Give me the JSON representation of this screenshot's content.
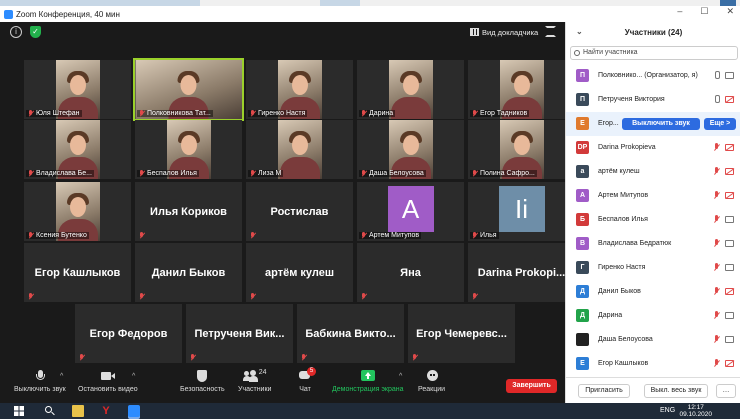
{
  "window": {
    "title": "Zoom Конференция, 40 мин",
    "controls": [
      "–",
      "☐",
      "✕"
    ]
  },
  "topbar": {
    "view_label": "Вид докладчика"
  },
  "colors": {
    "active_border": "#9bd12b",
    "end_button": "#e02828",
    "share": "#22c55e",
    "accent_blue": "#2d6be0"
  },
  "tiles": [
    {
      "name": "Юля Штефан",
      "kind": "video"
    },
    {
      "name": "Полковникова Тат...",
      "kind": "video",
      "active": true
    },
    {
      "name": "Гиренко Настя",
      "kind": "video"
    },
    {
      "name": "Дарина",
      "kind": "video"
    },
    {
      "name": "Егор Тадников",
      "kind": "video"
    },
    {
      "name": "Владислава Бе...",
      "kind": "video"
    },
    {
      "name": "Беспалов Илья",
      "kind": "video"
    },
    {
      "name": "Лиза М",
      "kind": "video"
    },
    {
      "name": "Даша Белоусова",
      "kind": "video"
    },
    {
      "name": "Полина Сафро...",
      "kind": "video"
    },
    {
      "name": "Ксения Бутенко",
      "kind": "video"
    },
    {
      "name": "Илья Кориков",
      "kind": "text"
    },
    {
      "name": "Ростислав",
      "kind": "text"
    },
    {
      "name": "Артем Митупов",
      "kind": "avatar",
      "letter": "A",
      "color": "#a05cc7"
    },
    {
      "name": "Илья",
      "kind": "avatar",
      "letter": "Ii",
      "color": "#6e8ea8"
    },
    {
      "name": "Егор Кашлыков",
      "kind": "text"
    },
    {
      "name": "Данил Быков",
      "kind": "text"
    },
    {
      "name": "артём кулеш",
      "kind": "text"
    },
    {
      "name": "Яна",
      "kind": "text"
    },
    {
      "name": "Darina Prokopi...",
      "kind": "text"
    },
    {
      "name": "Егор Федоров",
      "kind": "text"
    },
    {
      "name": "Петрученя Вик...",
      "kind": "text"
    },
    {
      "name": "Бабкина Викто...",
      "kind": "text"
    },
    {
      "name": "Егор Чемеревс...",
      "kind": "text"
    }
  ],
  "toolbar": {
    "mute": "Выключить звук",
    "video": "Остановить видео",
    "security": "Безопасность",
    "participants": "Участники",
    "participants_count": "24",
    "chat": "Чат",
    "chat_badge": "5",
    "share": "Демонстрация экрана",
    "reactions": "Реакции",
    "end": "Завершить"
  },
  "panel": {
    "title": "Участники (24)",
    "search_placeholder": "Найти участника",
    "mute_button": "Выключить звук",
    "more_button": "Еще >",
    "invite": "Пригласить",
    "mute_all": "Выкл. весь звук",
    "participants": [
      {
        "initial": "П",
        "name": "Полковнико... (Организатор, я)",
        "color": "#a05cc7",
        "mic": "on",
        "cam": "on"
      },
      {
        "initial": "П",
        "name": "Петрученя Виктория",
        "color": "#3a4a5a",
        "mic": "on",
        "cam": "off"
      },
      {
        "initial": "Е",
        "name": "Егор...",
        "color": "#e07a2d",
        "highlight": true
      },
      {
        "initial": "DP",
        "name": "Darina Prokopieva",
        "color": "#d23a3a",
        "mic": "muted",
        "cam": "off"
      },
      {
        "initial": "а",
        "name": "артём кулеш",
        "color": "#3a4a5a",
        "mic": "muted",
        "cam": "off"
      },
      {
        "initial": "А",
        "name": "Артем Митупов",
        "color": "#a05cc7",
        "mic": "muted",
        "cam": "off"
      },
      {
        "initial": "Б",
        "name": "Беспалов Илья",
        "color": "#d23a3a",
        "mic": "muted",
        "cam": "on"
      },
      {
        "initial": "В",
        "name": "Владислава Бедратюк",
        "color": "#a05cc7",
        "mic": "muted",
        "cam": "on"
      },
      {
        "initial": "Г",
        "name": "Гиренко Настя",
        "color": "#3a4a5a",
        "mic": "muted",
        "cam": "on"
      },
      {
        "initial": "Д",
        "name": "Данил Быков",
        "color": "#2d7ed6",
        "mic": "muted",
        "cam": "off"
      },
      {
        "initial": "Д",
        "name": "Дарина",
        "color": "#22a34a",
        "mic": "muted",
        "cam": "on"
      },
      {
        "initial": "",
        "name": "Даша Белоусова",
        "color": "#222",
        "mic": "muted",
        "cam": "on"
      },
      {
        "initial": "Е",
        "name": "Егор Кашлыков",
        "color": "#2d7ed6",
        "mic": "muted",
        "cam": "off"
      }
    ]
  },
  "taskbar": {
    "lang": "ENG",
    "time": "12:17",
    "date": "09.10.2020"
  }
}
